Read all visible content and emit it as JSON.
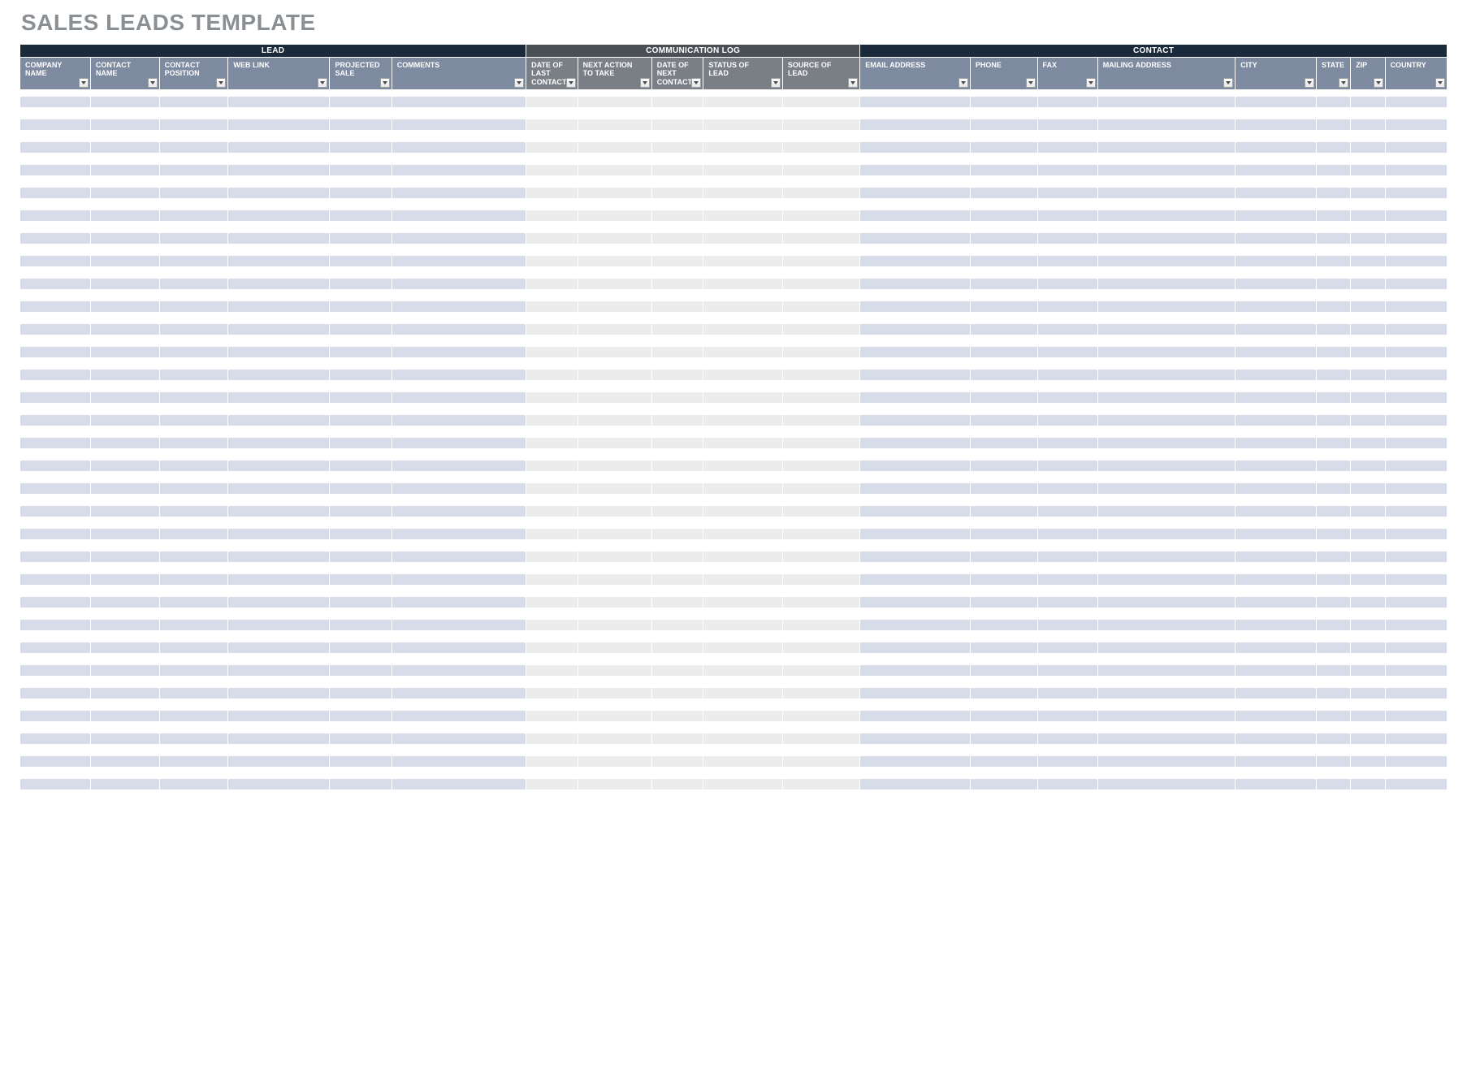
{
  "title": "SALES LEADS TEMPLATE",
  "row_count": 62,
  "groups": [
    {
      "label": "LEAD",
      "span": 6,
      "cls": "grp-lead"
    },
    {
      "label": "COMMUNICATION LOG",
      "span": 5,
      "cls": "grp-comm"
    },
    {
      "label": "CONTACT",
      "span": 8,
      "cls": "grp-contact"
    }
  ],
  "columns": [
    {
      "label": "COMPANY NAME",
      "width": "w-company",
      "hdr": "hdr-lead",
      "sec": "sec-lead"
    },
    {
      "label": "CONTACT NAME",
      "width": "w-name",
      "hdr": "hdr-lead",
      "sec": "sec-lead"
    },
    {
      "label": "CONTACT POSITION",
      "width": "w-position",
      "hdr": "hdr-lead",
      "sec": "sec-lead"
    },
    {
      "label": "WEB LINK",
      "width": "w-weblink",
      "hdr": "hdr-lead",
      "sec": "sec-lead"
    },
    {
      "label": "PROJECTED SALE",
      "width": "w-projected",
      "hdr": "hdr-lead",
      "sec": "sec-lead"
    },
    {
      "label": "COMMENTS",
      "width": "w-comments",
      "hdr": "hdr-lead",
      "sec": "sec-lead"
    },
    {
      "label": "DATE OF LAST CONTACT",
      "width": "w-datelast",
      "hdr": "hdr-comm",
      "sec": "sec-comm"
    },
    {
      "label": "NEXT ACTION TO TAKE",
      "width": "w-nextact",
      "hdr": "hdr-comm",
      "sec": "sec-comm"
    },
    {
      "label": "DATE OF NEXT CONTACT",
      "width": "w-datenext",
      "hdr": "hdr-comm",
      "sec": "sec-comm"
    },
    {
      "label": "STATUS OF LEAD",
      "width": "w-status",
      "hdr": "hdr-comm",
      "sec": "sec-comm"
    },
    {
      "label": "SOURCE OF LEAD",
      "width": "w-source",
      "hdr": "hdr-comm",
      "sec": "sec-comm"
    },
    {
      "label": "EMAIL ADDRESS",
      "width": "w-email",
      "hdr": "hdr-contact",
      "sec": "sec-contact"
    },
    {
      "label": "PHONE",
      "width": "w-phone",
      "hdr": "hdr-contact",
      "sec": "sec-contact"
    },
    {
      "label": "FAX",
      "width": "w-fax",
      "hdr": "hdr-contact",
      "sec": "sec-contact"
    },
    {
      "label": "MAILING ADDRESS",
      "width": "w-mailing",
      "hdr": "hdr-contact",
      "sec": "sec-contact"
    },
    {
      "label": "CITY",
      "width": "w-city",
      "hdr": "hdr-contact",
      "sec": "sec-contact"
    },
    {
      "label": "STATE",
      "width": "w-state",
      "hdr": "hdr-contact",
      "sec": "sec-contact"
    },
    {
      "label": "ZIP",
      "width": "w-zip",
      "hdr": "hdr-contact",
      "sec": "sec-contact"
    },
    {
      "label": "COUNTRY",
      "width": "w-country",
      "hdr": "hdr-contact",
      "sec": "sec-contact"
    }
  ]
}
